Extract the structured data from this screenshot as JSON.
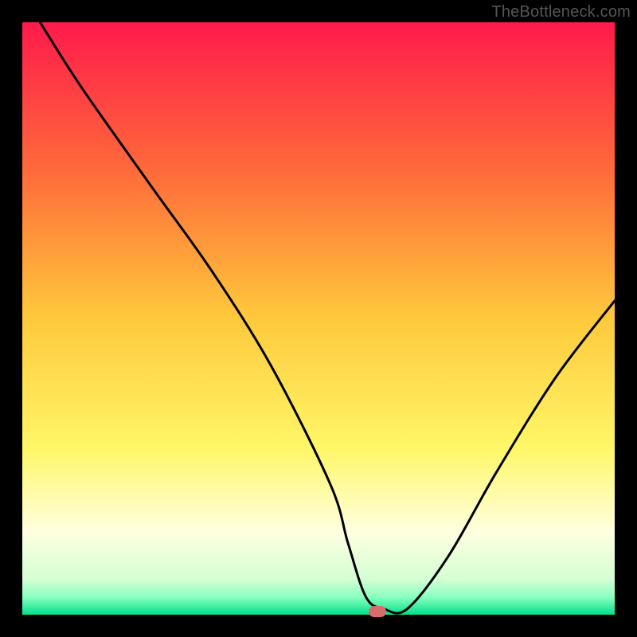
{
  "watermark": "TheBottleneck.com",
  "chart_data": {
    "type": "line",
    "title": "",
    "xlabel": "",
    "ylabel": "",
    "ylim": [
      0,
      100
    ],
    "xlim": [
      0,
      100
    ],
    "x": [
      3,
      10,
      22,
      32,
      42,
      52,
      55,
      58,
      61,
      65,
      72,
      80,
      90,
      100
    ],
    "values": [
      100,
      89,
      72,
      58,
      42,
      22,
      12,
      3,
      1,
      1,
      10,
      24,
      40,
      53
    ],
    "gradient_stops": [
      {
        "offset": 0.0,
        "color": "#ff1a4b"
      },
      {
        "offset": 0.25,
        "color": "#ff6a3a"
      },
      {
        "offset": 0.5,
        "color": "#ffc93c"
      },
      {
        "offset": 0.72,
        "color": "#fff768"
      },
      {
        "offset": 0.86,
        "color": "#ffffe0"
      },
      {
        "offset": 0.94,
        "color": "#d4ffd4"
      },
      {
        "offset": 0.97,
        "color": "#8affc0"
      },
      {
        "offset": 1.0,
        "color": "#00e08a"
      }
    ],
    "marker": {
      "x": 60,
      "y": 0,
      "color": "#d86b6b"
    },
    "curve_color": "#000000"
  }
}
